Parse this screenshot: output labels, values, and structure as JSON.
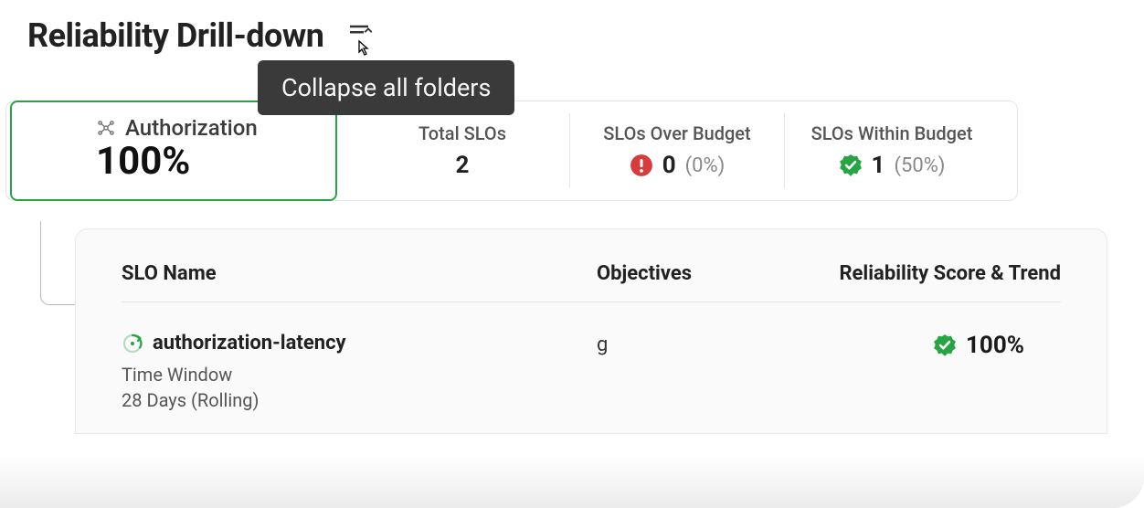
{
  "header": {
    "title": "Reliability Drill-down",
    "tooltip": "Collapse all folders"
  },
  "summary": {
    "name": "Authorization",
    "score": "100%",
    "totalLabel": "Total SLOs",
    "totalCount": "2",
    "overLabel": "SLOs Over Budget",
    "overCount": "0",
    "overPct": "(0%)",
    "withinLabel": "SLOs Within Budget",
    "withinCount": "1",
    "withinPct": "(50%)"
  },
  "table": {
    "headers": {
      "name": "SLO Name",
      "objectives": "Objectives",
      "score": "Reliability Score & Trend"
    },
    "rows": [
      {
        "name": "authorization-latency",
        "twLabel": "Time Window",
        "twValue": "28 Days (Rolling)",
        "objectives": "g",
        "score": "100%"
      }
    ]
  }
}
